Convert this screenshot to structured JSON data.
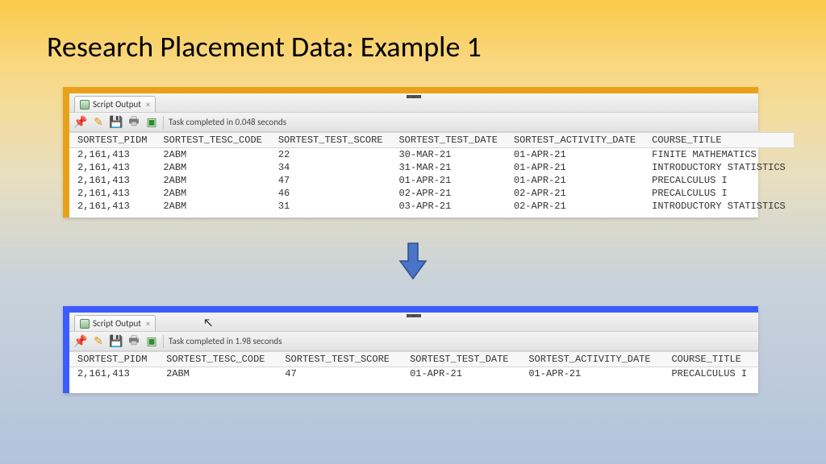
{
  "title": "Research Placement Data: Example 1",
  "panels": {
    "top": {
      "tab_label": "Script Output",
      "task_msg": "Task completed in 0.048 seconds",
      "columns": [
        "SORTEST_PIDM",
        "SORTEST_TESC_CODE",
        "SORTEST_TEST_SCORE",
        "SORTEST_TEST_DATE",
        "SORTEST_ACTIVITY_DATE",
        "COURSE_TITLE"
      ],
      "rows": [
        [
          "2,161,413",
          "2ABM",
          "22",
          "30-MAR-21",
          "01-APR-21",
          "FINITE MATHEMATICS"
        ],
        [
          "2,161,413",
          "2ABM",
          "34",
          "31-MAR-21",
          "01-APR-21",
          "INTRODUCTORY STATISTICS"
        ],
        [
          "2,161,413",
          "2ABM",
          "47",
          "01-APR-21",
          "01-APR-21",
          "PRECALCULUS I"
        ],
        [
          "2,161,413",
          "2ABM",
          "46",
          "02-APR-21",
          "02-APR-21",
          "PRECALCULUS I"
        ],
        [
          "2,161,413",
          "2ABM",
          "31",
          "03-APR-21",
          "02-APR-21",
          "INTRODUCTORY STATISTICS"
        ]
      ]
    },
    "bottom": {
      "tab_label": "Script Output",
      "task_msg": "Task completed in 1.98 seconds",
      "columns": [
        "SORTEST_PIDM",
        "SORTEST_TESC_CODE",
        "SORTEST_TEST_SCORE",
        "SORTEST_TEST_DATE",
        "SORTEST_ACTIVITY_DATE",
        "COURSE_TITLE"
      ],
      "rows": [
        [
          "2,161,413",
          "2ABM",
          "47",
          "01-APR-21",
          "01-APR-21",
          "PRECALCULUS I"
        ]
      ]
    }
  }
}
